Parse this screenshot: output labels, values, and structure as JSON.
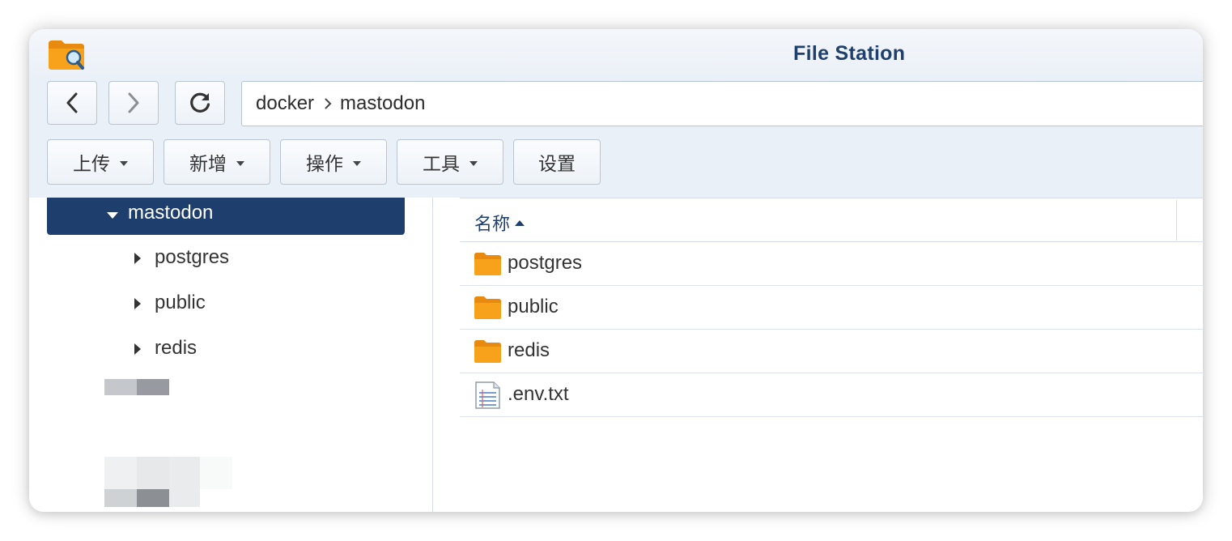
{
  "window": {
    "title": "File Station"
  },
  "nav": {
    "back": "back",
    "forward": "forward",
    "refresh": "refresh"
  },
  "path": {
    "segments": [
      "docker",
      "mastodon"
    ]
  },
  "actions": {
    "upload": "上传",
    "create": "新增",
    "action": "操作",
    "tools": "工具",
    "settings": "设置"
  },
  "tree": {
    "selected": "mastodon",
    "children": [
      "postgres",
      "public",
      "redis"
    ]
  },
  "list": {
    "header_name": "名称",
    "sort": "ascending",
    "rows": [
      {
        "name": "postgres",
        "icon": "folder-icon"
      },
      {
        "name": "public",
        "icon": "folder-icon"
      },
      {
        "name": "redis",
        "icon": "folder-icon"
      },
      {
        "name": ".env.txt",
        "icon": "text-file-icon"
      }
    ]
  },
  "colors": {
    "accent": "#1e3f6e",
    "folder": "#f7a21a",
    "title": "#1f3f6e"
  }
}
